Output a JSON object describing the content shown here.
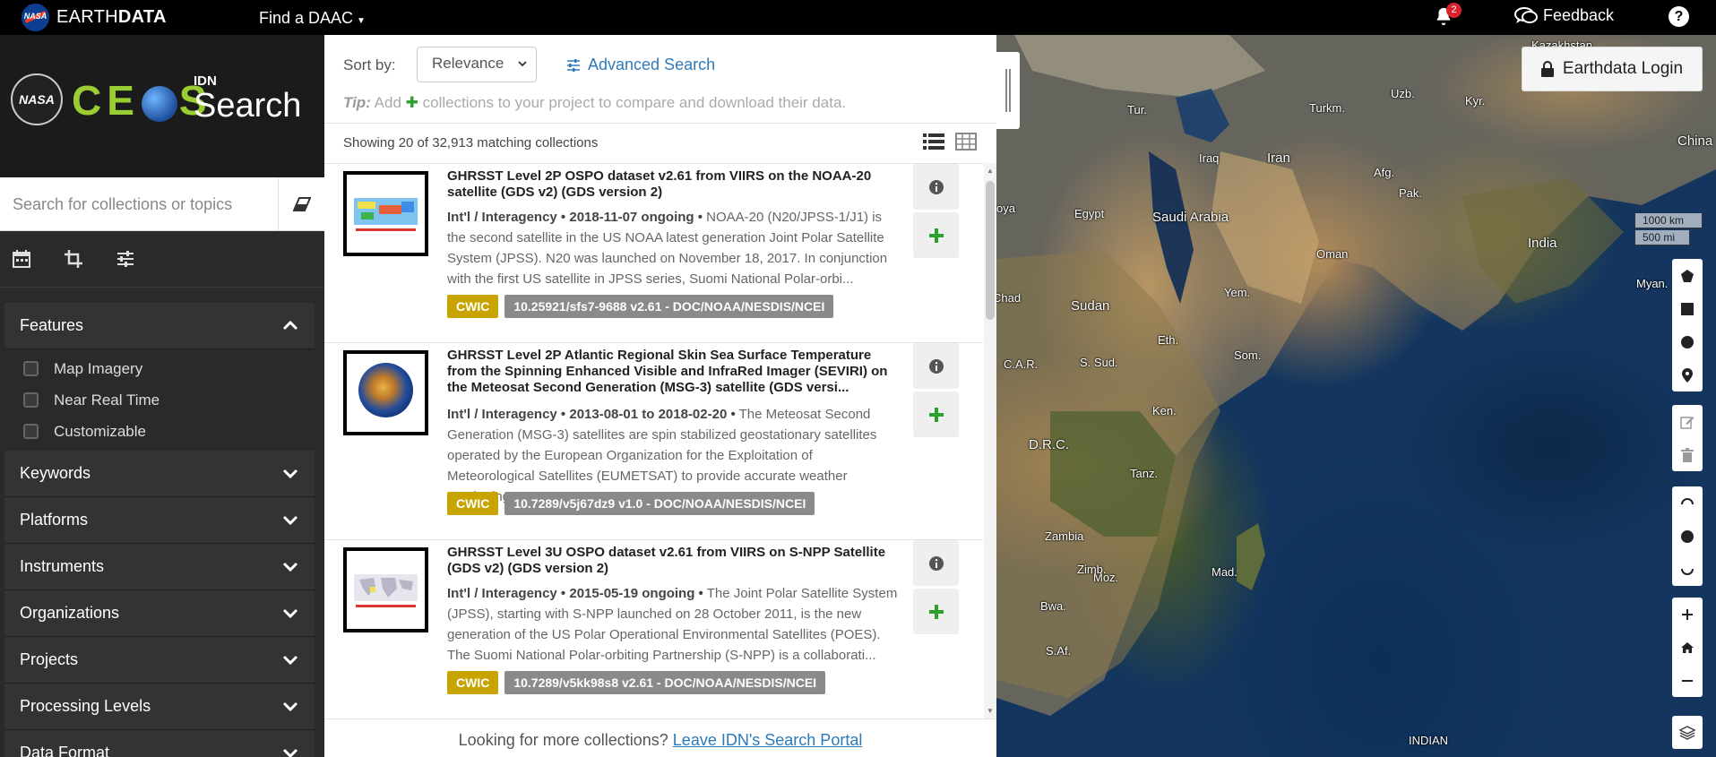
{
  "topbar": {
    "nasa_logo": "NASA",
    "brand_light": "EARTH",
    "brand_bold": "DATA",
    "find_daac": "Find a DAAC",
    "notification_count": "2",
    "feedback": "Feedback",
    "help": "?"
  },
  "sidebar": {
    "logo_nasa": "NASA",
    "logo_ceos_left": "CE",
    "logo_ceos_right": "S",
    "logo_idn": "IDN",
    "logo_search": "Search",
    "search_placeholder": "Search for collections or topics",
    "facets": [
      {
        "title": "Features",
        "expanded": true,
        "options": [
          "Map Imagery",
          "Near Real Time",
          "Customizable"
        ]
      },
      {
        "title": "Keywords"
      },
      {
        "title": "Platforms"
      },
      {
        "title": "Instruments"
      },
      {
        "title": "Organizations"
      },
      {
        "title": "Projects"
      },
      {
        "title": "Processing Levels"
      },
      {
        "title": "Data Format"
      }
    ]
  },
  "results": {
    "sort_label": "Sort by:",
    "sort_value": "Relevance",
    "advanced_search": "Advanced Search",
    "tip_label": "Tip:",
    "tip_add": "Add",
    "tip_rest": "collections to your project to compare and download their data.",
    "showing": "Showing 20 of 32,913 matching collections",
    "items": [
      {
        "title": "GHRSST Level 2P OSPO dataset v2.61 from VIIRS on the NOAA-20 satellite (GDS v2) (GDS version 2)",
        "meta_bold": "Int'l / Interagency • 2018-11-07 ongoing •",
        "description": "NOAA-20 (N20/JPSS-1/J1) is the second satellite in the US NOAA latest generation Joint Polar Satellite System (JPSS). N20 was launched on November 18, 2017. In conjunction with the first US satellite in JPSS series, Suomi National Polar-orbi...",
        "tag_cwic": "CWIC",
        "tag_doi": "10.25921/sfs7-9688 v2.61 - DOC/NOAA/NESDIS/NCEI"
      },
      {
        "title": "GHRSST Level 2P Atlantic Regional Skin Sea Surface Temperature from the Spinning Enhanced Visible and InfraRed Imager (SEVIRI) on the Meteosat Second Generation (MSG-3) satellite (GDS versi...",
        "meta_bold": "Int'l / Interagency • 2013-08-01 to 2018-02-20 •",
        "description": "The Meteosat Second Generation (MSG-3) satellites are spin stabilized geostationary satellites operated by the European Organization for the Exploitation of Meteorological Satellites (EUMETSAT) to provide accurate weather monitoring ...",
        "tag_cwic": "CWIC",
        "tag_doi": "10.7289/v5j67dz9 v1.0 - DOC/NOAA/NESDIS/NCEI"
      },
      {
        "title": "GHRSST Level 3U OSPO dataset v2.61 from VIIRS on S-NPP Satellite (GDS v2) (GDS version 2)",
        "meta_bold": "Int'l / Interagency • 2015-05-19 ongoing •",
        "description": "The Joint Polar Satellite System (JPSS), starting with S-NPP launched on 28 October 2011, is the new generation of the US Polar Operational Environmental Satellites (POES). The Suomi National Polar-orbiting Partnership (S-NPP) is a collaborati...",
        "tag_cwic": "CWIC",
        "tag_doi": "10.7289/v5kk98s8 v2.61 - DOC/NOAA/NESDIS/NCEI"
      }
    ],
    "footer_text": "Looking for more collections?",
    "footer_link": "Leave IDN's Search Portal"
  },
  "map": {
    "login": "Earthdata Login",
    "scale_km": "1000 km",
    "scale_mi": "500 mi",
    "labels": [
      "Kazakhstan",
      "Tur.",
      "Turkm.",
      "Uzb.",
      "Kyr.",
      "China",
      "Iraq",
      "Iran",
      "Afg.",
      "Pak.",
      "oya",
      "Egypt",
      "Saudi Arabia",
      "India",
      "Oman",
      "Myan.",
      "Chad",
      "Sudan",
      "Yem.",
      "C.A.R.",
      "S. Sud.",
      "Eth.",
      "Som.",
      "D.R.C.",
      "Ken.",
      "Tanz.",
      "Zambia",
      "Moz.",
      "Mad.",
      "Zimb.",
      "Bwa.",
      "S.Af.",
      "INDIAN"
    ]
  }
}
